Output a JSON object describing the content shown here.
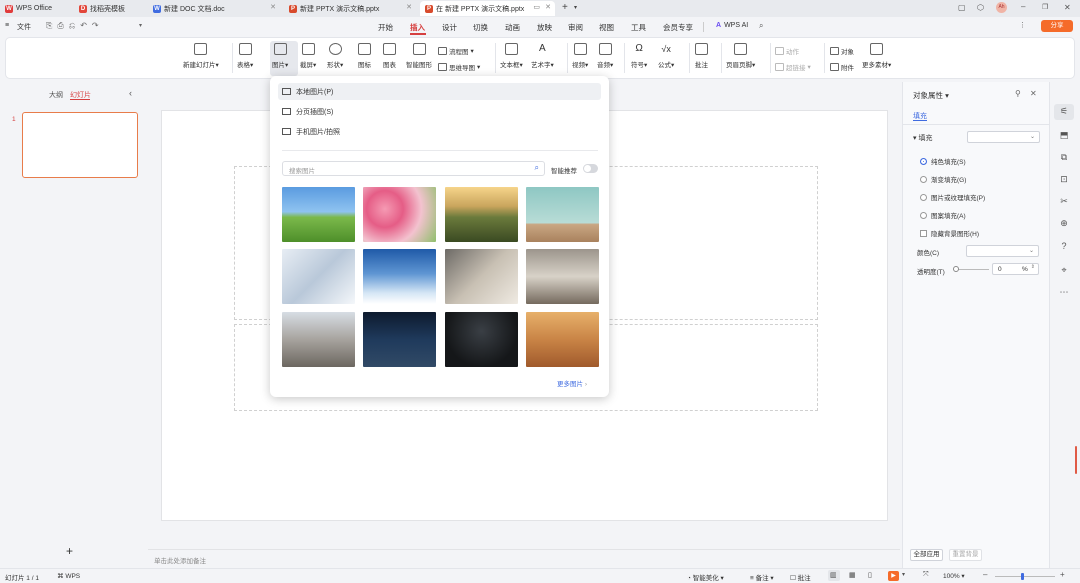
{
  "tabs": [
    {
      "label": "WPS Office",
      "color": "#e03b3b",
      "glyph": "W"
    },
    {
      "label": "找稻壳模板",
      "color": "#e2463a",
      "glyph": "D"
    },
    {
      "label": "新建 DOC 文档.doc",
      "color": "#3f6be0",
      "glyph": "W"
    },
    {
      "label": "新建 PPTX 演示文稿.pptx",
      "color": "#d84a2c",
      "glyph": "P"
    },
    {
      "label": "在 新建 PPTX 演示文稿.pptx",
      "color": "#d84a2c",
      "glyph": "P"
    }
  ],
  "quick": {
    "file": "文件"
  },
  "menu": [
    "开始",
    "插入",
    "设计",
    "切换",
    "动画",
    "放映",
    "审阅",
    "视图",
    "工具",
    "会员专享"
  ],
  "menu_active": "插入",
  "wps_ai": "WPS AI",
  "share": "分享",
  "avatar": "Ah",
  "ribbon": {
    "new_slide": "新建幻灯片",
    "table": "表格",
    "picture": "图片",
    "screenshot": "截屏",
    "shape": "形状",
    "icon": "图标",
    "chart": "图表",
    "smartart": "智能图形",
    "flowchart": "流程图",
    "mindmap": "思维导图",
    "textbox": "文本框",
    "wordart": "艺术字",
    "video": "视频",
    "audio": "音频",
    "symbol": "符号",
    "formula": "公式",
    "comment": "批注",
    "header_footer": "页眉页脚",
    "action": "动作",
    "hyperlink": "超链接",
    "object": "对象",
    "attachment": "附件",
    "more": "更多素材"
  },
  "left": {
    "outline": "大纲",
    "slides": "幻灯片",
    "slide_num": "1",
    "add": "+"
  },
  "notes_placeholder": "单击此处添加备注",
  "popup": {
    "local": "本地图片(P)",
    "paged": "分页插图(S)",
    "phone": "手机图片/拍照",
    "search_placeholder": "搜索图片",
    "smart": "智能推荐",
    "more": "更多图片"
  },
  "right": {
    "title": "对象属性",
    "tab": "填充",
    "fill": "填充",
    "solid": "纯色填充(S)",
    "gradient": "渐变填充(G)",
    "picture_fill": "图片或纹理填充(P)",
    "pattern": "图案填充(A)",
    "hide_bg": "隐藏背景图形(H)",
    "color": "颜色(C)",
    "transparency": "透明度(T)",
    "transparency_value": "0",
    "percent": "%",
    "apply_all": "全部应用",
    "reset": "重置背景"
  },
  "status": {
    "slide": "幻灯片 1 / 1",
    "theme": "WPS",
    "beautify": "智能美化",
    "notes": "备注",
    "comments": "批注",
    "zoom": "100%"
  },
  "colors": {
    "accent": "#d64040",
    "blue": "#3f6be0",
    "share": "#f56b2a"
  }
}
